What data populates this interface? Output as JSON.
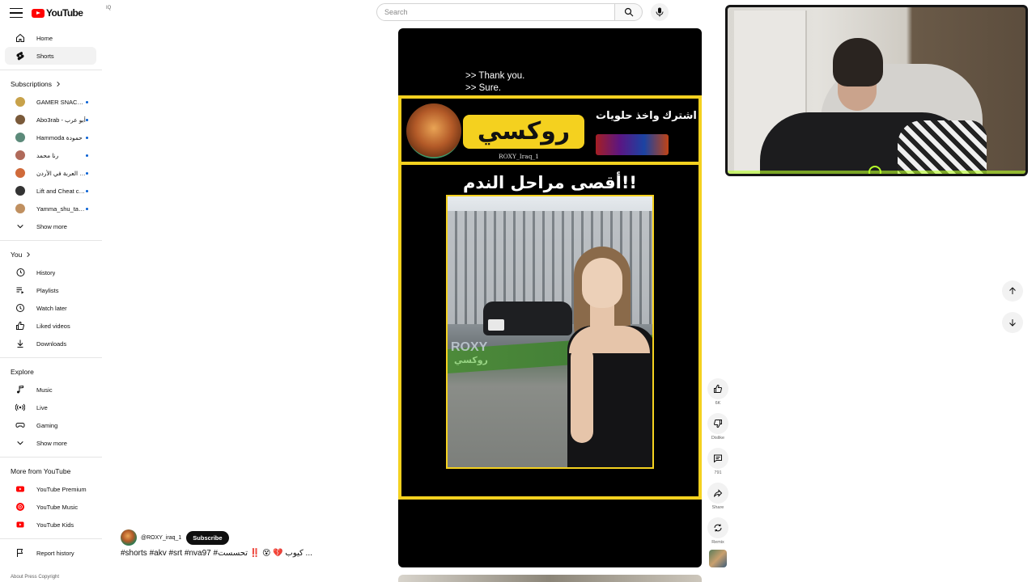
{
  "header": {
    "logo_text": "YouTube",
    "logo_country": "IQ",
    "search_placeholder": "Search"
  },
  "sidebar": {
    "main": [
      {
        "label": "Home",
        "icon": "home-icon"
      },
      {
        "label": "Shorts",
        "icon": "shorts-icon",
        "active": true
      }
    ],
    "subscriptions_title": "Subscriptions",
    "subscriptions": [
      {
        "label": "GAMER SNACK | ...",
        "color": "#c8a24a"
      },
      {
        "label": "Abo3rab - أبو عرب",
        "color": "#7a5a3a"
      },
      {
        "label": "Hammoda حمودة",
        "color": "#5c8a7a"
      },
      {
        "label": "رنا محمد",
        "color": "#b06a5a"
      },
      {
        "label": "دو جرة العربة في الأردن",
        "color": "#d06a3a"
      },
      {
        "label": "Lift and Cheat chan...",
        "color": "#333333"
      },
      {
        "label": "Yamma_shu_tabkha...",
        "color": "#c09060"
      }
    ],
    "subscriptions_more": "Show more",
    "you_title": "You",
    "you_items": [
      {
        "label": "History",
        "icon": "history-icon"
      },
      {
        "label": "Playlists",
        "icon": "playlists-icon"
      },
      {
        "label": "Watch later",
        "icon": "watch-later-icon"
      },
      {
        "label": "Liked videos",
        "icon": "liked-icon"
      },
      {
        "label": "Downloads",
        "icon": "download-icon"
      }
    ],
    "explore_title": "Explore",
    "explore_items": [
      {
        "label": "Music",
        "icon": "music-icon"
      },
      {
        "label": "Live",
        "icon": "live-icon"
      },
      {
        "label": "Gaming",
        "icon": "gaming-icon"
      },
      {
        "label": "Show more",
        "icon": "chevron-down-icon"
      }
    ],
    "more_title": "More from YouTube",
    "more_items": [
      {
        "label": "YouTube Premium"
      },
      {
        "label": "YouTube Music"
      },
      {
        "label": "YouTube Kids"
      }
    ],
    "report_history": "Report history",
    "footer": "About  Press  Copyright"
  },
  "video": {
    "captions_line1": ">> Thank you.",
    "captions_line2": ">> Sure.",
    "brand_name": "روكسي",
    "brand_handle": "ROXY_Iraq_1",
    "promo_text": "اشترك واخذ حلويات",
    "headline": "أقصى مراحل الندم!!",
    "watermark_en": "ROXY",
    "watermark_ar": "روكسي"
  },
  "actions": [
    {
      "label": "6K",
      "icon": "thumbs-up-icon"
    },
    {
      "label": "Dislike",
      "icon": "thumbs-down-icon"
    },
    {
      "label": "791",
      "icon": "comment-icon"
    },
    {
      "label": "Share",
      "icon": "share-icon"
    },
    {
      "label": "Remix",
      "icon": "remix-icon"
    }
  ],
  "channel": {
    "handle": "@ROXY_iraq_1",
    "subscribe_label": "Subscribe",
    "title": "#shorts #akv #srt #nva97 #كيوب 💔 😵 ‼️ تحسست ..."
  },
  "colors": {
    "accent": "#ff0000",
    "banner_yellow": "#f4d11f",
    "subscribe_bg": "#0f0f0f"
  }
}
